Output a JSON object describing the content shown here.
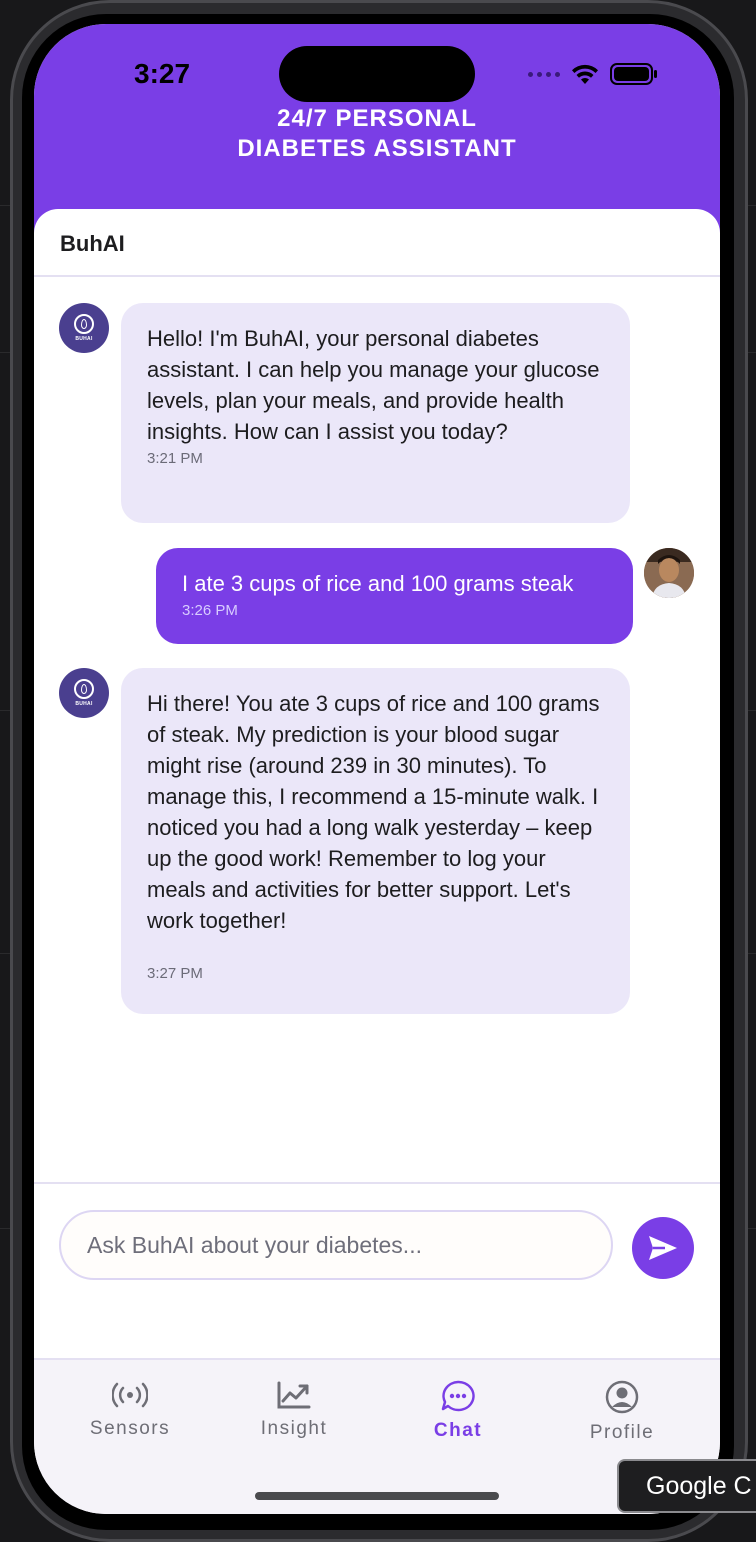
{
  "status_bar": {
    "time": "3:27"
  },
  "header": {
    "title_line1": "24/7 PERSONAL",
    "title_line2": "DIABETES ASSISTANT"
  },
  "chat": {
    "title": "BuhAI",
    "bot_avatar_label": "BUHAI",
    "messages": [
      {
        "sender": "bot",
        "text": "Hello! I'm BuhAI, your personal diabetes assistant. I can help you manage your glucose levels, plan your meals, and provide health insights. How can I assist you today?",
        "time": "3:21 PM"
      },
      {
        "sender": "user",
        "text": "I ate 3 cups of rice and 100 grams steak",
        "time": "3:26 PM"
      },
      {
        "sender": "bot",
        "text": "Hi there!  You ate 3 cups of rice and 100 grams of steak. My prediction is your blood sugar might rise (around 239 in 30 minutes). To manage this, I recommend a 15-minute walk.  I noticed you had a long walk yesterday – keep up the good work! Remember to log your meals and activities for better support. Let's work together!",
        "time": "3:27 PM"
      }
    ]
  },
  "input": {
    "placeholder": "Ask BuhAI about your diabetes...",
    "value": ""
  },
  "tabs": [
    {
      "label": "Sensors",
      "icon": "sensors-icon",
      "active": false
    },
    {
      "label": "Insight",
      "icon": "chart-trend-icon",
      "active": false
    },
    {
      "label": "Chat",
      "icon": "chat-bubble-icon",
      "active": true
    },
    {
      "label": "Profile",
      "icon": "user-circle-icon",
      "active": false
    }
  ],
  "tooltip": {
    "text": "Google C"
  },
  "colors": {
    "accent": "#7a3ee6",
    "bot_bubble": "#ebe7f9",
    "tab_inactive": "#6e6e76"
  }
}
